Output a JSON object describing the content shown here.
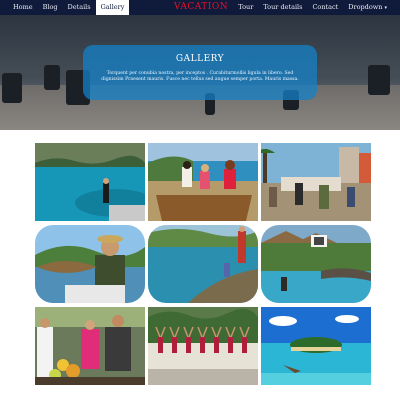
{
  "nav": {
    "left": [
      "Home",
      "Blog",
      "Details",
      "Gallery"
    ],
    "active": "Gallery",
    "brand": "VACATION",
    "right": [
      "Tour",
      "Tour details",
      "Contact",
      "Dropdown"
    ]
  },
  "hero": {
    "title": "GALLERY",
    "text": "Torquent per conubia nostra, per inceptos . Curabiturmollis ligula in libero. Sed dignissim Praesent mauris. Fusce nec tellus sed augue semper porta. Mauris massa."
  },
  "gallery": {
    "photos": [
      "lake-fishing-photo",
      "beach-friends-photo",
      "street-market-photo",
      "fish-catch-photo",
      "river-bank-photo",
      "resort-pool-photo",
      "fruit-market-photo",
      "beach-yoga-photo",
      "tropical-island-photo"
    ]
  },
  "colors": {
    "nav_bg": "#101a3a",
    "brand": "#e0112b",
    "panel": "#1482c8"
  }
}
